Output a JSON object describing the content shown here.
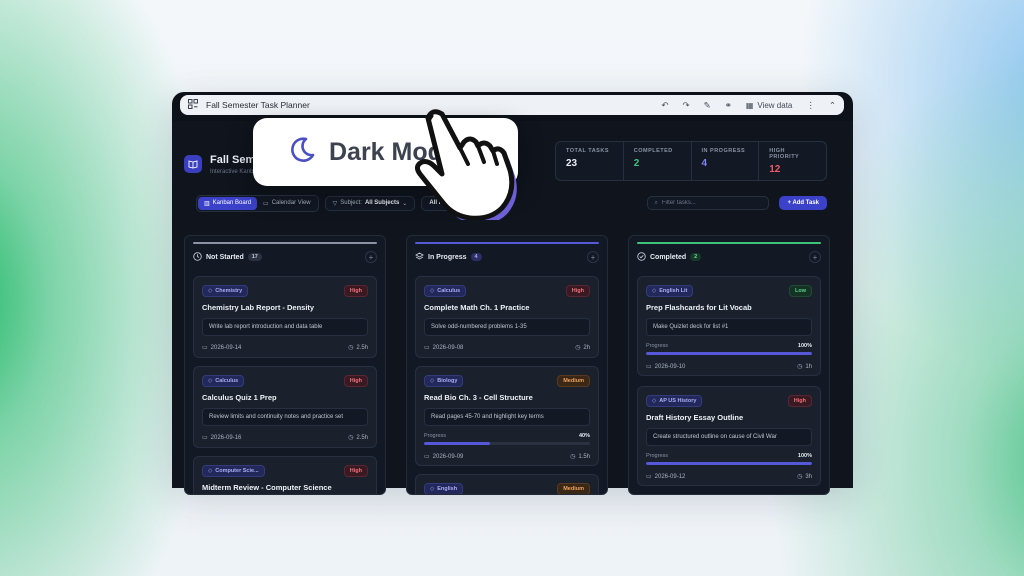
{
  "window": {
    "title": "Fall Semester Task Planner",
    "view_data_label": "View data"
  },
  "header": {
    "title": "Fall Semester Task Planner",
    "subtitle": "Interactive Kanban board",
    "stats": [
      {
        "label": "TOTAL TASKS",
        "value": "23",
        "color": "#e8ecf3"
      },
      {
        "label": "COMPLETED",
        "value": "2",
        "color": "#3ec27a"
      },
      {
        "label": "IN PROGRESS",
        "value": "4",
        "color": "#7f84f2"
      },
      {
        "label": "HIGH PRIORITY",
        "value": "12",
        "color": "#ef5a67"
      }
    ]
  },
  "toolbar": {
    "kanban_label": "Kanban Board",
    "calendar_label": "Calendar View",
    "subject_prefix": "Subject:",
    "subject_value": "All Subjects",
    "priority_value": "All Priorities",
    "search_placeholder": "Filter tasks...",
    "add_label": "Add Task"
  },
  "overlay": {
    "label": "Dark Mode"
  },
  "columns": [
    {
      "title": "Not Started",
      "count": "17",
      "bar_color": "#8a93a3",
      "count_bg": "#2a3242",
      "count_color": "#c0c7d2",
      "cards": [
        {
          "tag": "Chemistry",
          "priority": "High",
          "priority_class": "high",
          "title": "Chemistry Lab Report - Density",
          "desc": "Write lab report introduction and data table",
          "date": "2026-09-14",
          "hours": "2.5h"
        },
        {
          "tag": "Calculus",
          "priority": "High",
          "priority_class": "high",
          "title": "Calculus Quiz 1 Prep",
          "desc": "Review limits and continuity notes and practice set",
          "date": "2026-09-16",
          "hours": "2.5h"
        },
        {
          "tag": "Computer Scie...",
          "priority": "High",
          "priority_class": "high",
          "title": "Midterm Review - Computer Science"
        }
      ]
    },
    {
      "title": "In Progress",
      "count": "4",
      "bar_color": "#5458d9",
      "count_bg": "#2b2f63",
      "count_color": "#a8acf5",
      "cards": [
        {
          "tag": "Calculus",
          "priority": "High",
          "priority_class": "high",
          "title": "Complete Math Ch. 1 Practice",
          "desc": "Solve odd-numbered problems 1-35",
          "date": "2026-09-08",
          "hours": "2h"
        },
        {
          "tag": "Biology",
          "priority": "Medium",
          "priority_class": "medium",
          "title": "Read Bio Ch. 3 - Cell Structure",
          "desc": "Read pages 45-70 and highlight key terms",
          "progress_label": "Progress",
          "progress": "40%",
          "progress_value": 40,
          "date": "2026-09-09",
          "hours": "1.5h"
        },
        {
          "tag": "English",
          "priority": "Medium",
          "priority_class": "medium"
        }
      ]
    },
    {
      "title": "Completed",
      "count": "2",
      "bar_color": "#3ec27a",
      "count_bg": "#173a28",
      "count_color": "#6fd79a",
      "cards": [
        {
          "tag": "English Lit",
          "priority": "Low",
          "priority_class": "low",
          "title": "Prep Flashcards for Lit Vocab",
          "desc": "Make Quizlet deck for list #1",
          "progress_label": "Progress",
          "progress": "100%",
          "progress_value": 100,
          "date": "2026-09-10",
          "hours": "1h"
        },
        {
          "tag": "AP US History",
          "priority": "High",
          "priority_class": "high",
          "title": "Draft History Essay Outline",
          "desc": "Create structured outline on cause of Civil War",
          "progress_label": "Progress",
          "progress": "100%",
          "progress_value": 100,
          "date": "2026-09-12",
          "hours": "3h"
        }
      ]
    }
  ],
  "colors": {
    "accent": "#3b41c9",
    "tag_bg": "#23285a",
    "tag_border": "#343b7d",
    "tag_text": "#a9aef6"
  }
}
